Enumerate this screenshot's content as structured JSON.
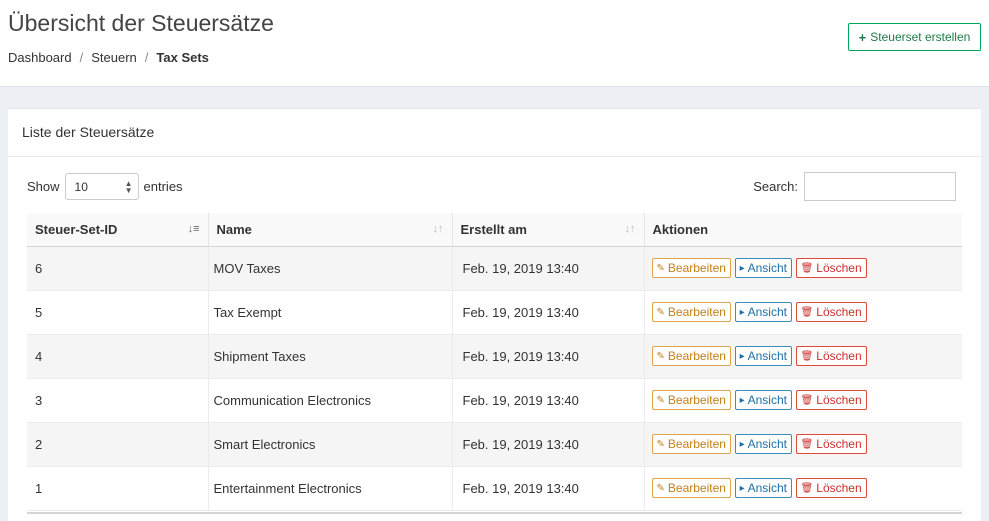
{
  "header": {
    "title": "Übersicht der Steuersätze",
    "create_button": "Steuerset erstellen",
    "breadcrumb": [
      "Dashboard",
      "Steuern",
      "Tax Sets"
    ]
  },
  "box": {
    "title": "Liste der Steuersätze",
    "show_label": "Show",
    "entries_value": "10",
    "entries_label": "entries",
    "search_label": "Search:",
    "search_value": ""
  },
  "table": {
    "columns": [
      "Steuer-Set-ID",
      "Name",
      "Erstellt am",
      "Aktionen"
    ],
    "rows": [
      {
        "id": "6",
        "name": "MOV Taxes",
        "created": "Feb. 19, 2019 13:40"
      },
      {
        "id": "5",
        "name": "Tax Exempt",
        "created": "Feb. 19, 2019 13:40"
      },
      {
        "id": "4",
        "name": "Shipment Taxes",
        "created": "Feb. 19, 2019 13:40"
      },
      {
        "id": "3",
        "name": "Communication Electronics",
        "created": "Feb. 19, 2019 13:40"
      },
      {
        "id": "2",
        "name": "Smart Electronics",
        "created": "Feb. 19, 2019 13:40"
      },
      {
        "id": "1",
        "name": "Entertainment Electronics",
        "created": "Feb. 19, 2019 13:40"
      }
    ],
    "actions": {
      "edit": "Bearbeiten",
      "view": "Ansicht",
      "delete": "Löschen"
    }
  },
  "colors": {
    "success": "#00a65a",
    "warning": "#e0a54a",
    "info": "#3c8dbc",
    "danger": "#dd4b39"
  },
  "icons": {
    "create": "plus-icon",
    "edit": "edit-icon",
    "view": "caret-right-icon",
    "delete": "trash-icon",
    "sort": "sort-icon"
  }
}
